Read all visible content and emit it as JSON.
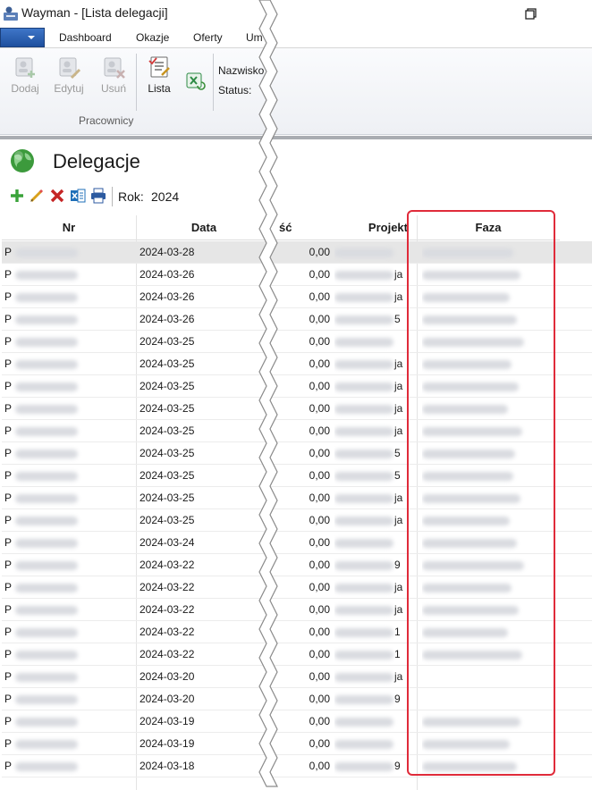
{
  "window": {
    "title": "Wayman - [Lista delegacji]"
  },
  "tabs": [
    "Dashboard",
    "Okazje",
    "Oferty",
    "Um"
  ],
  "ribbon": {
    "buttons": [
      "Dodaj",
      "Edytuj",
      "Usuń",
      "Lista"
    ],
    "group_label": "Pracownicy",
    "field_labels": [
      "Nazwisko",
      "Status:"
    ]
  },
  "page": {
    "title": "Delegacje",
    "rok_label": "Rok:",
    "rok_value": "2024"
  },
  "grid": {
    "headers": {
      "nr": "Nr",
      "data": "Data",
      "kwota": "ść",
      "projekt": "Projekt",
      "faza": "Faza"
    },
    "rows": [
      {
        "nr": "P",
        "data": "2024-03-28",
        "kwota": "0,00",
        "proj_tail": ""
      },
      {
        "nr": "P",
        "data": "2024-03-26",
        "kwota": "0,00",
        "proj_tail": "ja"
      },
      {
        "nr": "P",
        "data": "2024-03-26",
        "kwota": "0,00",
        "proj_tail": "ja"
      },
      {
        "nr": "P",
        "data": "2024-03-26",
        "kwota": "0,00",
        "proj_tail": "5"
      },
      {
        "nr": "P",
        "data": "2024-03-25",
        "kwota": "0,00",
        "proj_tail": ""
      },
      {
        "nr": "P",
        "data": "2024-03-25",
        "kwota": "0,00",
        "proj_tail": "ja"
      },
      {
        "nr": "P",
        "data": "2024-03-25",
        "kwota": "0,00",
        "proj_tail": "ja"
      },
      {
        "nr": "P",
        "data": "2024-03-25",
        "kwota": "0,00",
        "proj_tail": "ja"
      },
      {
        "nr": "P",
        "data": "2024-03-25",
        "kwota": "0,00",
        "proj_tail": "ja"
      },
      {
        "nr": "P",
        "data": "2024-03-25",
        "kwota": "0,00",
        "proj_tail": "5"
      },
      {
        "nr": "P",
        "data": "2024-03-25",
        "kwota": "0,00",
        "proj_tail": "5"
      },
      {
        "nr": "P",
        "data": "2024-03-25",
        "kwota": "0,00",
        "proj_tail": "ja"
      },
      {
        "nr": "P",
        "data": "2024-03-25",
        "kwota": "0,00",
        "proj_tail": "ja"
      },
      {
        "nr": "P",
        "data": "2024-03-24",
        "kwota": "0,00",
        "proj_tail": ""
      },
      {
        "nr": "P",
        "data": "2024-03-22",
        "kwota": "0,00",
        "proj_tail": "9"
      },
      {
        "nr": "P",
        "data": "2024-03-22",
        "kwota": "0,00",
        "proj_tail": "ja"
      },
      {
        "nr": "P",
        "data": "2024-03-22",
        "kwota": "0,00",
        "proj_tail": "ja"
      },
      {
        "nr": "P",
        "data": "2024-03-22",
        "kwota": "0,00",
        "proj_tail": "1"
      },
      {
        "nr": "P",
        "data": "2024-03-22",
        "kwota": "0,00",
        "proj_tail": "1"
      },
      {
        "nr": "P",
        "data": "2024-03-20",
        "kwota": "0,00",
        "proj_tail": "ja"
      },
      {
        "nr": "P",
        "data": "2024-03-20",
        "kwota": "0,00",
        "proj_tail": "9"
      },
      {
        "nr": "P",
        "data": "2024-03-19",
        "kwota": "0,00",
        "proj_tail": ""
      },
      {
        "nr": "P",
        "data": "2024-03-19",
        "kwota": "0,00",
        "proj_tail": ""
      },
      {
        "nr": "P",
        "data": "2024-03-18",
        "kwota": "0,00",
        "proj_tail": "9"
      }
    ]
  },
  "colors": {
    "highlight": "#e02b3a",
    "accent": "#1e4f9e"
  }
}
